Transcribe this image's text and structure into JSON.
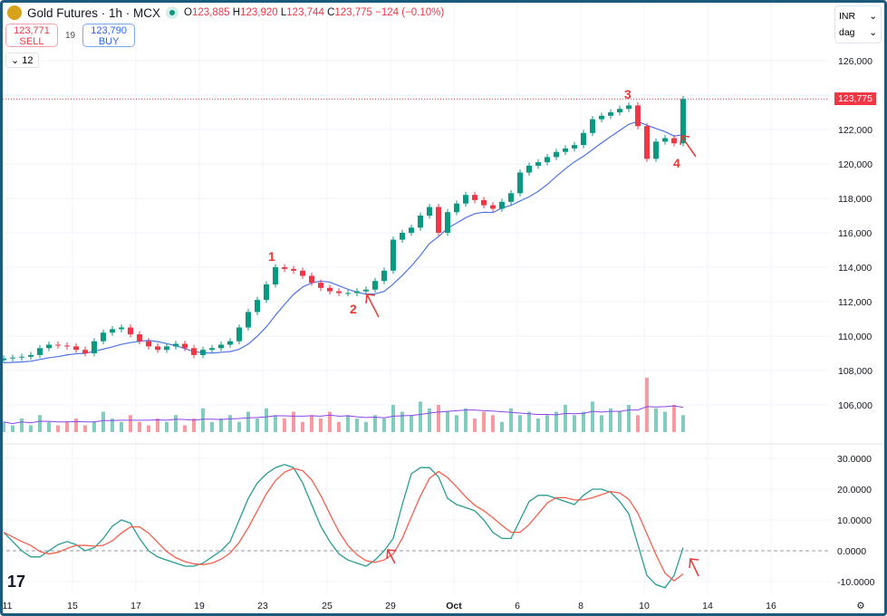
{
  "header": {
    "symbol": "Gold Futures · 1h · MCX",
    "open_label": "O",
    "open": "123,885",
    "high_label": "H",
    "high": "123,920",
    "low_label": "L",
    "low": "123,744",
    "close_label": "C",
    "close": "123,775",
    "change": "−124 (−0.10%)"
  },
  "trade": {
    "sell_price": "123,771",
    "sell_label": "SELL",
    "spread": "19",
    "buy_price": "123,790",
    "buy_label": "BUY"
  },
  "indicators_collapsed": "12",
  "currency": "INR",
  "unit": "dag",
  "last_price_tag": "123,775",
  "colors": {
    "up": "#089981",
    "down": "#f23645",
    "ma": "#4e74e6",
    "signal": "#f5604d",
    "osc": "#2a9d8f",
    "vol_ma": "#8e44ec",
    "annotation": "#e53935"
  },
  "chart_data": {
    "type": "candlestick",
    "title": "Gold Futures · 1h · MCX",
    "price_axis_ticks": [
      "126,000",
      "124,000",
      "122,000",
      "120,000",
      "118,000",
      "116,000",
      "114,000",
      "112,000",
      "110,000",
      "108,000",
      "106,000"
    ],
    "price_axis_values": [
      126000,
      124000,
      122000,
      120000,
      118000,
      116000,
      114000,
      112000,
      110000,
      108000,
      106000
    ],
    "osc_axis_ticks": [
      "30.0000",
      "20.0000",
      "10.0000",
      "0.0000",
      "-10.0000"
    ],
    "osc_axis_values": [
      30,
      20,
      10,
      0,
      -10
    ],
    "x_ticks": [
      "11",
      "15",
      "17",
      "19",
      "23",
      "25",
      "29",
      "Oct",
      "6",
      "8",
      "10",
      "14",
      "16"
    ],
    "closes": [
      108700,
      108750,
      108800,
      108900,
      109300,
      109500,
      109450,
      109400,
      109200,
      109000,
      109700,
      110200,
      110400,
      110500,
      110100,
      109700,
      109400,
      109200,
      109400,
      109550,
      109300,
      108900,
      109200,
      109300,
      109500,
      109700,
      110500,
      111400,
      112100,
      113000,
      114000,
      113900,
      113800,
      113500,
      113100,
      112800,
      112600,
      112500,
      112500,
      112600,
      112700,
      113200,
      113800,
      115600,
      116000,
      116300,
      117000,
      117500,
      116000,
      117200,
      117700,
      118200,
      117900,
      117600,
      117400,
      117800,
      118300,
      119500,
      119900,
      120100,
      120400,
      120700,
      120900,
      121100,
      121800,
      122600,
      122800,
      123000,
      123200,
      123400,
      122200,
      120300,
      121300,
      121500,
      121200,
      123775
    ],
    "volume": [
      3,
      2,
      4,
      2,
      5,
      3,
      2,
      3,
      4,
      2,
      3,
      6,
      4,
      3,
      5,
      3,
      2,
      4,
      3,
      5,
      2,
      4,
      7,
      3,
      4,
      5,
      3,
      6,
      4,
      7,
      5,
      4,
      6,
      3,
      5,
      4,
      6,
      3,
      5,
      4,
      3,
      5,
      4,
      8,
      6,
      5,
      9,
      7,
      8,
      6,
      5,
      7,
      4,
      6,
      5,
      3,
      7,
      5,
      6,
      4,
      5,
      6,
      8,
      5,
      6,
      9,
      5,
      7,
      6,
      8,
      5,
      16,
      7,
      6,
      8,
      5
    ],
    "oscillator": [
      6,
      3,
      0,
      -2,
      -2,
      0,
      2,
      3,
      2,
      0,
      1,
      4,
      8,
      10,
      9,
      4,
      0,
      -2,
      -3,
      -4,
      -5,
      -5,
      -4,
      -2,
      0,
      3,
      10,
      17,
      22,
      25,
      27,
      28,
      27,
      22,
      15,
      8,
      3,
      -1,
      -3,
      -4,
      -5,
      -3,
      0,
      4,
      15,
      25,
      27,
      27,
      24,
      17,
      15,
      14,
      13,
      10,
      6,
      4,
      4,
      10,
      16,
      18,
      18,
      17,
      16,
      15,
      18,
      20,
      20,
      19,
      16,
      12,
      2,
      -8,
      -11,
      -12,
      -8,
      1
    ],
    "annotations": [
      "1",
      "2",
      "3",
      "4"
    ]
  }
}
